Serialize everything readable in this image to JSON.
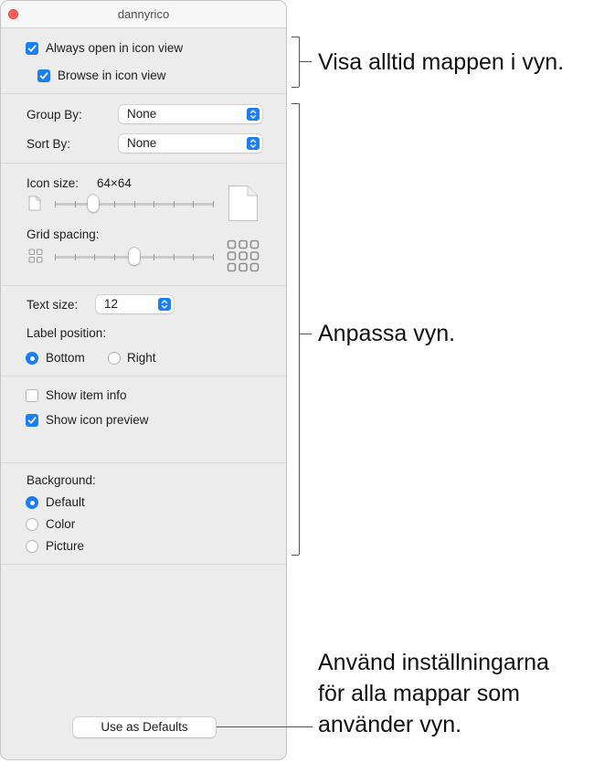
{
  "window": {
    "title": "dannyrico"
  },
  "options": {
    "always_open_icon_view": {
      "label": "Always open in icon view",
      "checked": true
    },
    "browse_icon_view": {
      "label": "Browse in icon view",
      "checked": true
    }
  },
  "grouping": {
    "group_by_label": "Group By:",
    "group_by_value": "None",
    "sort_by_label": "Sort By:",
    "sort_by_value": "None"
  },
  "icon_size": {
    "label": "Icon size:",
    "value": "64×64",
    "slider_fraction": 0.22
  },
  "grid_spacing": {
    "label": "Grid spacing:",
    "slider_fraction": 0.5
  },
  "text": {
    "text_size_label": "Text size:",
    "text_size_value": "12",
    "label_position_label": "Label position:",
    "bottom_label": "Bottom",
    "right_label": "Right",
    "selected_position": "Bottom"
  },
  "show": {
    "item_info": {
      "label": "Show item info",
      "checked": false
    },
    "icon_preview": {
      "label": "Show icon preview",
      "checked": true
    }
  },
  "background": {
    "label": "Background:",
    "options": [
      "Default",
      "Color",
      "Picture"
    ],
    "selected": "Default"
  },
  "defaults_button": {
    "label": "Use as Defaults"
  },
  "callouts": {
    "top": "Visa alltid mappen i vyn.",
    "middle": "Anpassa vyn.",
    "bottom_line1": "Använd inställningarna",
    "bottom_line2": "för alla mappar som",
    "bottom_line3": "använder vyn."
  },
  "colors": {
    "accent": "#1a7ef6",
    "close": "#fe5f57"
  }
}
